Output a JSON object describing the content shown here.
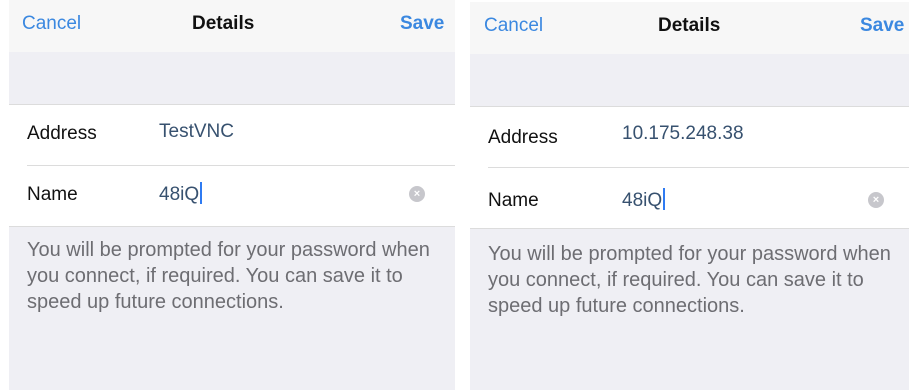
{
  "screens": [
    {
      "nav": {
        "cancel": "Cancel",
        "title": "Details",
        "save": "Save"
      },
      "fields": {
        "address": {
          "label": "Address",
          "value": "TestVNC"
        },
        "name": {
          "label": "Name",
          "value": "48iQ"
        }
      },
      "clear_icon": "×",
      "footer": "You will be prompted for your password when you connect, if required. You can save it to speed up future connections."
    },
    {
      "nav": {
        "cancel": "Cancel",
        "title": "Details",
        "save": "Save"
      },
      "fields": {
        "address": {
          "label": "Address",
          "value": "10.175.248.38"
        },
        "name": {
          "label": "Name",
          "value": "48iQ"
        }
      },
      "clear_icon": "×",
      "footer": "You will be prompted for your password when you connect, if required. You can save it to speed up future connections."
    }
  ],
  "colors": {
    "accent": "#3b88e0",
    "value_text": "#37516f",
    "background_gray": "#efeff4",
    "cursor": "#2f7bf2"
  }
}
